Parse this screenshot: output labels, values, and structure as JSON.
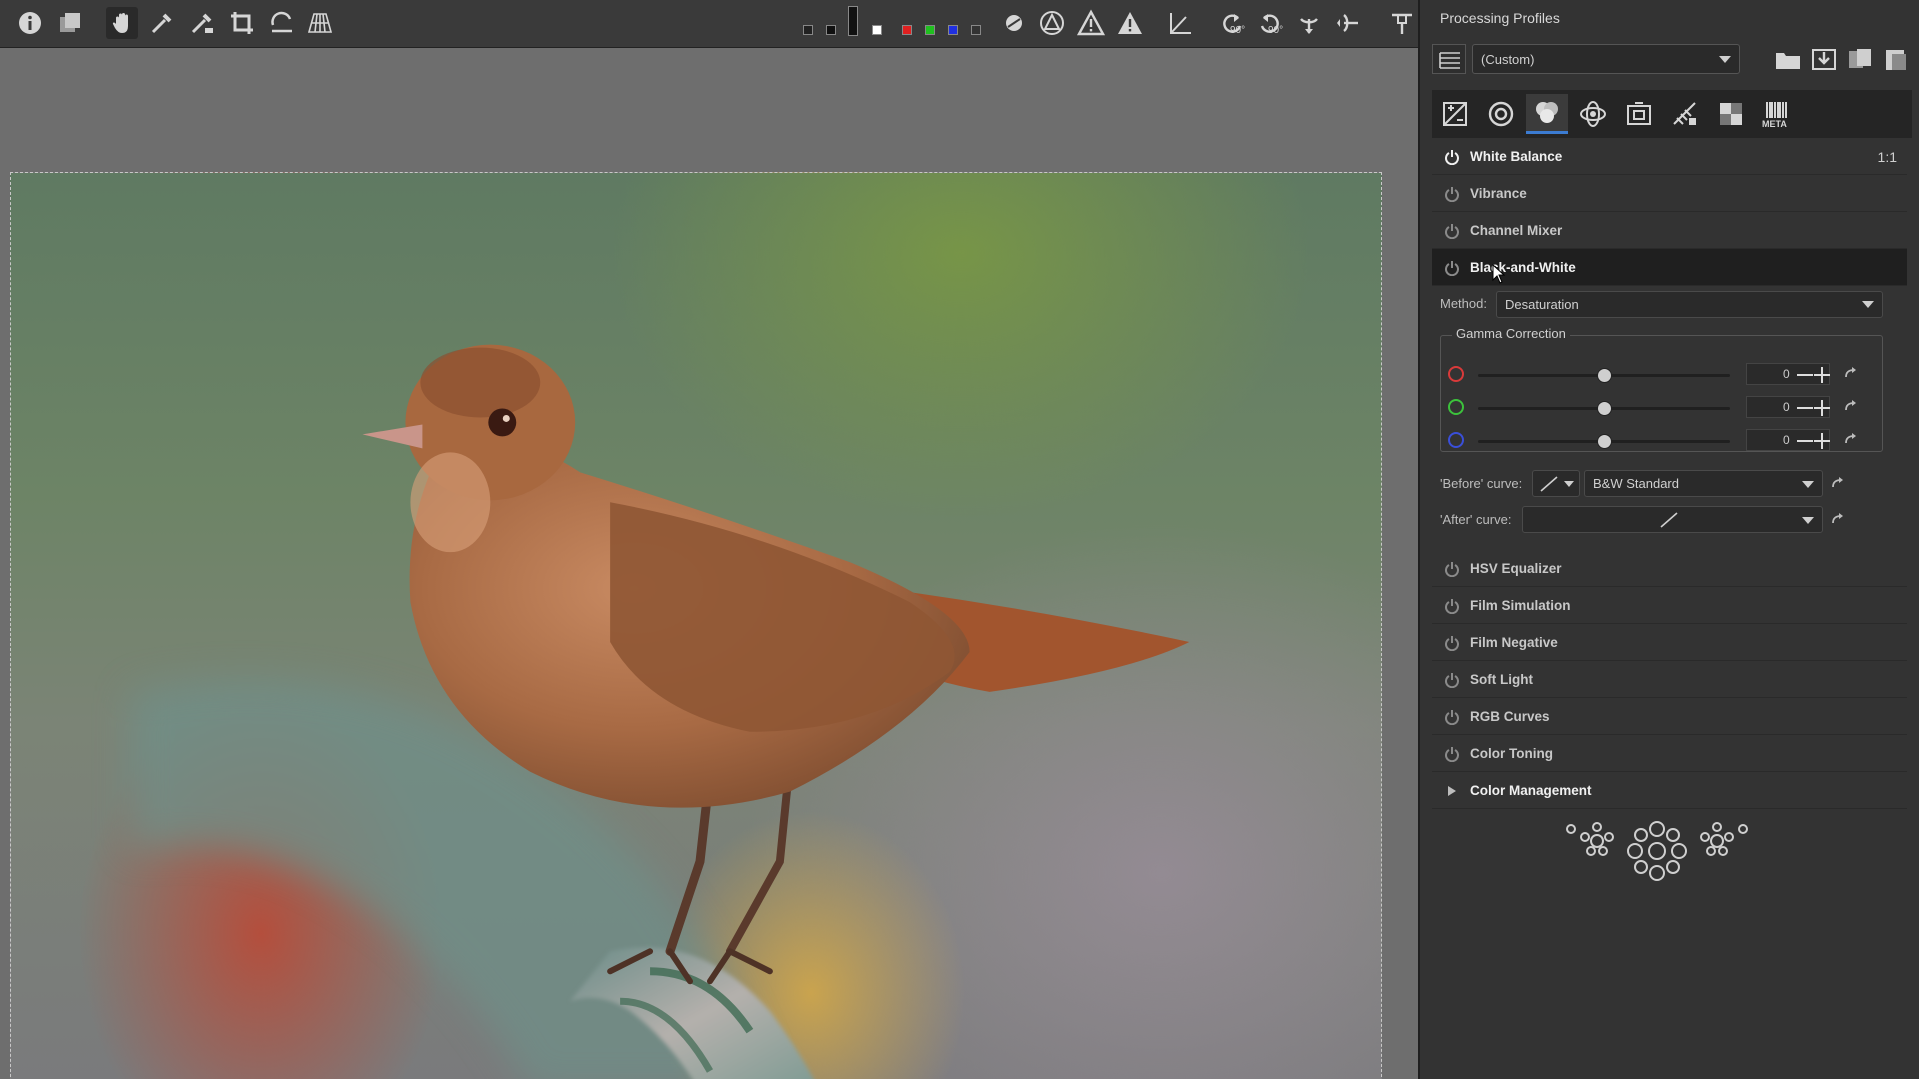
{
  "toolbar": {
    "left_icons": [
      "info-icon",
      "before-after-icon",
      "hand-icon",
      "white-balance-picker-icon",
      "color-picker-icon",
      "crop-icon",
      "straighten-icon",
      "perspective-icon"
    ],
    "right_icons": [
      "focus-mask-icon",
      "shadow-clip-icon",
      "highlight-warning-icon",
      "shadow-warning-icon",
      "horizon-icon",
      "rotate-left-icon",
      "rotate-right-icon",
      "flip-horizontal-icon",
      "flip-vertical-icon",
      "pin-icon"
    ],
    "rotate_left_label": "90°",
    "rotate_right_label": "90°"
  },
  "panel": {
    "processing_profiles_title": "Processing Profiles",
    "profile_select_value": "(Custom)",
    "tools": [
      {
        "label": "White Balance",
        "active": true
      },
      {
        "label": "Vibrance",
        "active": false
      },
      {
        "label": "Channel Mixer",
        "active": false
      },
      {
        "label": "Black-and-White",
        "active": false,
        "expanded": true
      },
      {
        "label": "HSV Equalizer",
        "active": false
      },
      {
        "label": "Film Simulation",
        "active": false
      },
      {
        "label": "Film Negative",
        "active": false
      },
      {
        "label": "Soft Light",
        "active": false
      },
      {
        "label": "RGB Curves",
        "active": false
      },
      {
        "label": "Color Toning",
        "active": false
      },
      {
        "label": "Color Management",
        "active": false,
        "collapsed_group": true
      }
    ],
    "zoom_label": "1:1",
    "tab_meta_label": "META",
    "black_and_white": {
      "method_label": "Method:",
      "method_value": "Desaturation",
      "gamma_title": "Gamma Correction",
      "gamma": [
        {
          "channel": "red",
          "color": "#d93a3a",
          "value": "0",
          "level": 0.5
        },
        {
          "channel": "green",
          "color": "#3cc23c",
          "value": "0",
          "level": 0.5
        },
        {
          "channel": "blue",
          "color": "#3a4fd9",
          "value": "0",
          "level": 0.5
        }
      ],
      "before_curve_label": "'Before' curve:",
      "before_curve_value": "B&W Standard",
      "after_curve_label": "'After' curve:"
    }
  },
  "colors": {
    "accent": "#3c7cd2",
    "panel_bg": "#333333",
    "canvas_bg": "#6e6e6e"
  }
}
